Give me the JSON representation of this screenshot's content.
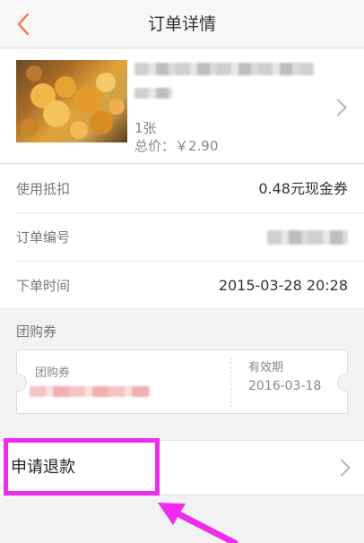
{
  "navbar": {
    "title": "订单详情",
    "back_icon": "chevron-left-icon",
    "accent_color": "#f4753c"
  },
  "product": {
    "quantity": "1张",
    "total_price": "总价：￥2.90"
  },
  "rows": {
    "discount": {
      "label": "使用抵扣",
      "value": "0.48元现金券"
    },
    "order_number": {
      "label": "订单编号"
    },
    "order_time": {
      "label": "下单时间",
      "value": "2015-03-28 20:28"
    }
  },
  "coupon": {
    "section_title": "团购券",
    "card_label": "团购券",
    "validity_label": "有效期",
    "validity_date": "2016-03-18"
  },
  "refund": {
    "label": "申请退款"
  },
  "annotation": {
    "highlight_color": "#ee2bee"
  }
}
